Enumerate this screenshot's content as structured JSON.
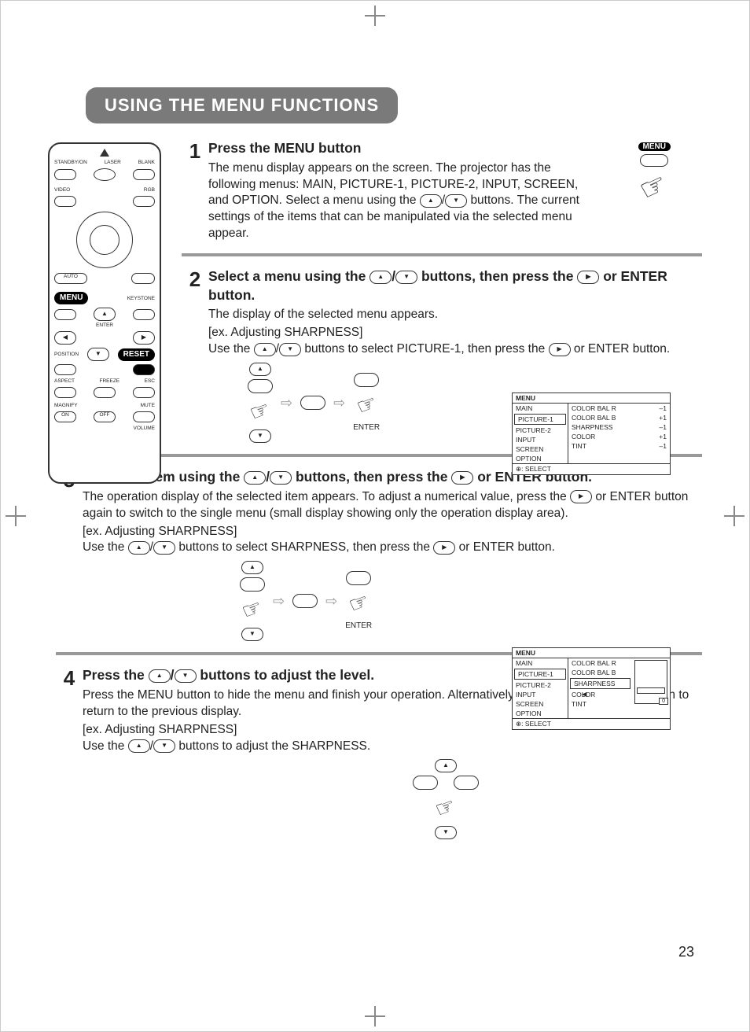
{
  "page_number": "23",
  "title": "USING THE MENU FUNCTIONS",
  "menu_button_label": "MENU",
  "step1": {
    "num": "1",
    "heading": "Press the MENU button",
    "body_a": "The menu display appears on the screen. The projector has the following menus: MAIN, PICTURE-1, PICTURE-2, INPUT, SCREEN, and OPTION. Select a menu using the ",
    "body_b": " buttons. The current settings of the items that can be manipulated via the selected menu appear."
  },
  "step2": {
    "num": "2",
    "heading_a": "Select a menu using the ",
    "heading_b": " buttons, then press the ",
    "heading_c": " or ENTER button.",
    "body1": "The display of the selected menu appears.",
    "ex": "[ex. Adjusting SHARPNESS]",
    "body2a": "Use the ",
    "body2b": " buttons to select PICTURE-1, then press the ",
    "body2c": " or ENTER button.",
    "enter_label": "ENTER"
  },
  "step3": {
    "num": "3",
    "heading_a": "Select an item using the ",
    "heading_b": " buttons, then press the ",
    "heading_c": " or ENTER button.",
    "body1a": "The operation display of the selected item appears. To adjust a numerical value, press the ",
    "body1b": " or ENTER button again to switch to the single menu (small display showing only the operation display area).",
    "ex": "[ex. Adjusting SHARPNESS]",
    "body2a": "Use the ",
    "body2b": " buttons to select SHARPNESS, then press the ",
    "body2c": " or ENTER button.",
    "enter_label": "ENTER"
  },
  "step4": {
    "num": "4",
    "heading_a": "Press the ",
    "heading_b": " buttons to adjust the level.",
    "body1a": "Press the MENU button to hide the menu and finish your operation. Alternatively, press the ",
    "body1b": " or ESC button to return to the previous display.",
    "ex": "[ex. Adjusting SHARPNESS]",
    "body2a": "Use the ",
    "body2b": " buttons to adjust the SHARPNESS."
  },
  "remote": {
    "standby": "STANDBY/ON",
    "laser": "LASER",
    "blank": "BLANK",
    "video": "VIDEO",
    "rgb": "RGB",
    "auto": "AUTO",
    "menu": "MENU",
    "keystone": "KEYSTONE",
    "enter": "ENTER",
    "position": "POSITION",
    "reset": "RESET",
    "aspect": "ASPECT",
    "freeze": "FREEZE",
    "esc": "ESC",
    "magnify": "MAGNIFY",
    "on": "ON",
    "off": "OFF",
    "mute": "MUTE",
    "volume": "VOLUME"
  },
  "osd1": {
    "header": "MENU",
    "left": [
      "MAIN",
      "PICTURE-1",
      "PICTURE-2",
      "INPUT",
      "SCREEN",
      "OPTION"
    ],
    "selected": "PICTURE-1",
    "right": [
      {
        "k": "COLOR BAL R",
        "v": "–1"
      },
      {
        "k": "COLOR BAL B",
        "v": "+1"
      },
      {
        "k": "SHARPNESS",
        "v": "–1"
      },
      {
        "k": "COLOR",
        "v": "+1"
      },
      {
        "k": "TINT",
        "v": "–1"
      }
    ],
    "footer": ": SELECT"
  },
  "osd2": {
    "header": "MENU",
    "left": [
      "MAIN",
      "PICTURE-1",
      "PICTURE-2",
      "INPUT",
      "SCREEN",
      "OPTION"
    ],
    "selected": "PICTURE-1",
    "right_items": [
      "COLOR BAL R",
      "COLOR BAL B",
      "SHARPNESS",
      "COLOR",
      "TINT"
    ],
    "right_selected": "SHARPNESS",
    "slider_value": "0",
    "footer": ": SELECT"
  }
}
